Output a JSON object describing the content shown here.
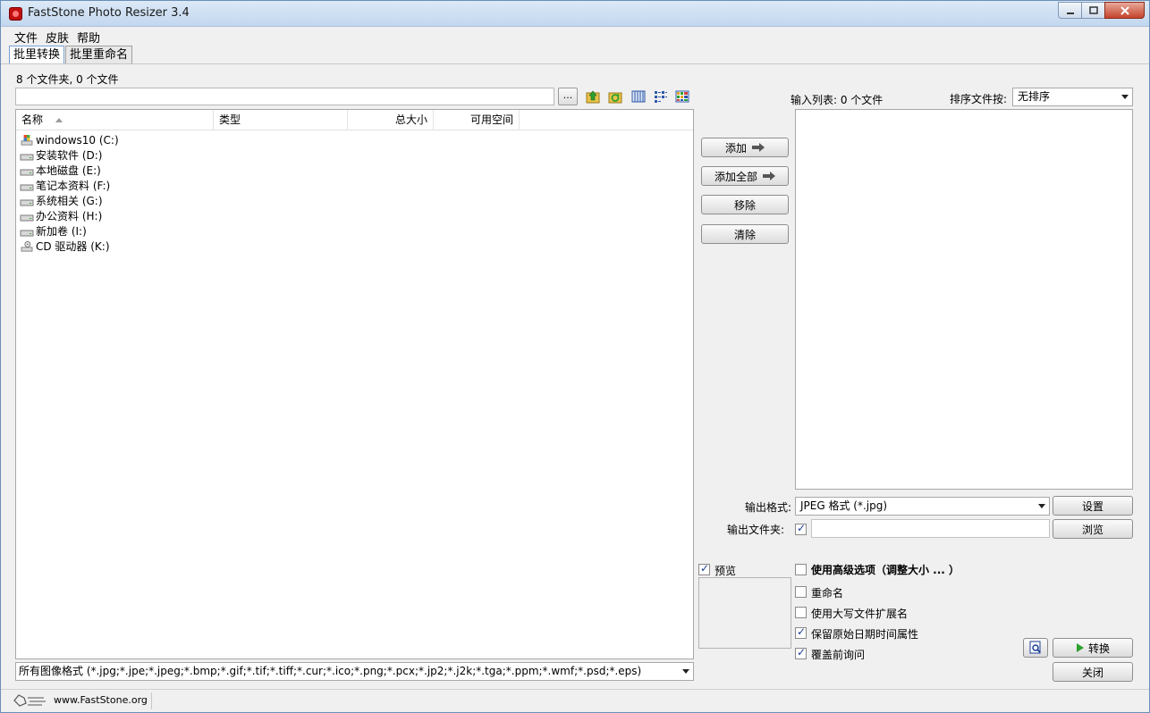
{
  "window": {
    "title": "FastStone Photo Resizer 3.4"
  },
  "menu": [
    "文件",
    "皮肤",
    "帮助"
  ],
  "tabs": [
    {
      "label": "批里转换",
      "active": true
    },
    {
      "label": "批里重命名",
      "active": false
    }
  ],
  "browser": {
    "count_label": "8 个文件夹, 0 个文件",
    "path_value": "",
    "browse_button": "...",
    "toolbar_icons": [
      "folder-up-icon",
      "refresh-icon",
      "view-thumbnails-icon",
      "view-list-icon",
      "view-details-icon"
    ],
    "columns": [
      "名称",
      "类型",
      "总大小",
      "可用空间"
    ],
    "drives": [
      {
        "label": "windows10 (C:)",
        "icon": "system-drive-icon"
      },
      {
        "label": "安装软件 (D:)",
        "icon": "drive-icon"
      },
      {
        "label": "本地磁盘 (E:)",
        "icon": "drive-icon"
      },
      {
        "label": "笔记本资料 (F:)",
        "icon": "drive-icon"
      },
      {
        "label": "系统相关 (G:)",
        "icon": "drive-icon"
      },
      {
        "label": "办公资料 (H:)",
        "icon": "drive-icon"
      },
      {
        "label": "新加卷 (I:)",
        "icon": "drive-icon"
      },
      {
        "label": "CD 驱动器 (K:)",
        "icon": "cd-drive-icon"
      }
    ],
    "filter": "所有图像格式 (*.jpg;*.jpe;*.jpeg;*.bmp;*.gif;*.tif;*.tiff;*.cur;*.ico;*.png;*.pcx;*.jp2;*.j2k;*.tga;*.ppm;*.wmf;*.psd;*.eps)"
  },
  "actions": {
    "add": "添加",
    "add_all": "添加全部",
    "remove": "移除",
    "clear": "清除"
  },
  "input_list": {
    "label": "输入列表: 0 个文件",
    "sort_label": "排序文件按:",
    "sort_value": "无排序"
  },
  "output": {
    "format_label": "输出格式:",
    "format_value": "JPEG 格式 (*.jpg)",
    "settings_button": "设置",
    "folder_label": "输出文件夹:",
    "folder_checked": true,
    "folder_value": "",
    "browse_button": "浏览"
  },
  "preview": {
    "label": "预览",
    "checked": true
  },
  "options": [
    {
      "label": "使用高级选项（调整大小 ... ）",
      "checked": false,
      "bold": true
    },
    {
      "label": "重命名",
      "checked": false,
      "bold": false
    },
    {
      "label": "使用大写文件扩展名",
      "checked": false,
      "bold": false
    },
    {
      "label": "保留原始日期时间属性",
      "checked": true,
      "bold": false
    },
    {
      "label": "覆盖前询问",
      "checked": true,
      "bold": false
    }
  ],
  "bottom_buttons": {
    "convert": "转换",
    "close": "关闭"
  },
  "status": {
    "url": "www.FastStone.org"
  },
  "colors": {
    "accent": "#1c3f94",
    "title_bar": "#c2d7ee",
    "convert_arrow": "#2ea02e"
  }
}
